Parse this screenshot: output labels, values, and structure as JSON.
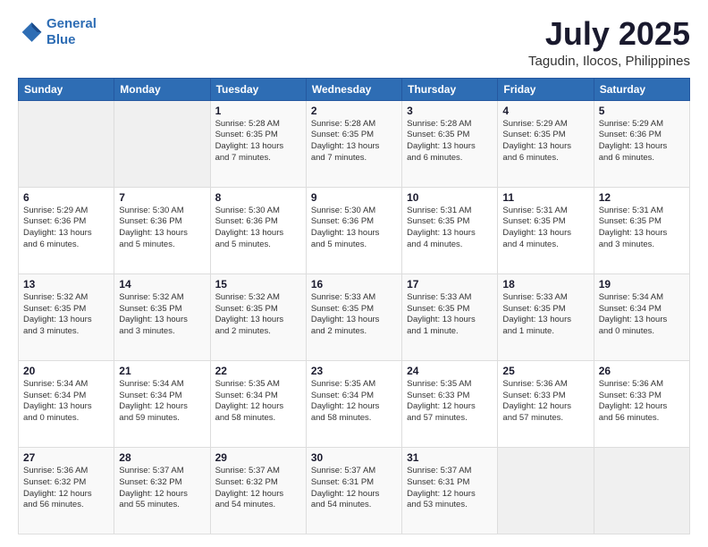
{
  "logo": {
    "line1": "General",
    "line2": "Blue"
  },
  "title": "July 2025",
  "subtitle": "Tagudin, Ilocos, Philippines",
  "weekdays": [
    "Sunday",
    "Monday",
    "Tuesday",
    "Wednesday",
    "Thursday",
    "Friday",
    "Saturday"
  ],
  "weeks": [
    [
      {
        "day": "",
        "info": ""
      },
      {
        "day": "",
        "info": ""
      },
      {
        "day": "1",
        "info": "Sunrise: 5:28 AM\nSunset: 6:35 PM\nDaylight: 13 hours\nand 7 minutes."
      },
      {
        "day": "2",
        "info": "Sunrise: 5:28 AM\nSunset: 6:35 PM\nDaylight: 13 hours\nand 7 minutes."
      },
      {
        "day": "3",
        "info": "Sunrise: 5:28 AM\nSunset: 6:35 PM\nDaylight: 13 hours\nand 6 minutes."
      },
      {
        "day": "4",
        "info": "Sunrise: 5:29 AM\nSunset: 6:35 PM\nDaylight: 13 hours\nand 6 minutes."
      },
      {
        "day": "5",
        "info": "Sunrise: 5:29 AM\nSunset: 6:36 PM\nDaylight: 13 hours\nand 6 minutes."
      }
    ],
    [
      {
        "day": "6",
        "info": "Sunrise: 5:29 AM\nSunset: 6:36 PM\nDaylight: 13 hours\nand 6 minutes."
      },
      {
        "day": "7",
        "info": "Sunrise: 5:30 AM\nSunset: 6:36 PM\nDaylight: 13 hours\nand 5 minutes."
      },
      {
        "day": "8",
        "info": "Sunrise: 5:30 AM\nSunset: 6:36 PM\nDaylight: 13 hours\nand 5 minutes."
      },
      {
        "day": "9",
        "info": "Sunrise: 5:30 AM\nSunset: 6:36 PM\nDaylight: 13 hours\nand 5 minutes."
      },
      {
        "day": "10",
        "info": "Sunrise: 5:31 AM\nSunset: 6:35 PM\nDaylight: 13 hours\nand 4 minutes."
      },
      {
        "day": "11",
        "info": "Sunrise: 5:31 AM\nSunset: 6:35 PM\nDaylight: 13 hours\nand 4 minutes."
      },
      {
        "day": "12",
        "info": "Sunrise: 5:31 AM\nSunset: 6:35 PM\nDaylight: 13 hours\nand 3 minutes."
      }
    ],
    [
      {
        "day": "13",
        "info": "Sunrise: 5:32 AM\nSunset: 6:35 PM\nDaylight: 13 hours\nand 3 minutes."
      },
      {
        "day": "14",
        "info": "Sunrise: 5:32 AM\nSunset: 6:35 PM\nDaylight: 13 hours\nand 3 minutes."
      },
      {
        "day": "15",
        "info": "Sunrise: 5:32 AM\nSunset: 6:35 PM\nDaylight: 13 hours\nand 2 minutes."
      },
      {
        "day": "16",
        "info": "Sunrise: 5:33 AM\nSunset: 6:35 PM\nDaylight: 13 hours\nand 2 minutes."
      },
      {
        "day": "17",
        "info": "Sunrise: 5:33 AM\nSunset: 6:35 PM\nDaylight: 13 hours\nand 1 minute."
      },
      {
        "day": "18",
        "info": "Sunrise: 5:33 AM\nSunset: 6:35 PM\nDaylight: 13 hours\nand 1 minute."
      },
      {
        "day": "19",
        "info": "Sunrise: 5:34 AM\nSunset: 6:34 PM\nDaylight: 13 hours\nand 0 minutes."
      }
    ],
    [
      {
        "day": "20",
        "info": "Sunrise: 5:34 AM\nSunset: 6:34 PM\nDaylight: 13 hours\nand 0 minutes."
      },
      {
        "day": "21",
        "info": "Sunrise: 5:34 AM\nSunset: 6:34 PM\nDaylight: 12 hours\nand 59 minutes."
      },
      {
        "day": "22",
        "info": "Sunrise: 5:35 AM\nSunset: 6:34 PM\nDaylight: 12 hours\nand 58 minutes."
      },
      {
        "day": "23",
        "info": "Sunrise: 5:35 AM\nSunset: 6:34 PM\nDaylight: 12 hours\nand 58 minutes."
      },
      {
        "day": "24",
        "info": "Sunrise: 5:35 AM\nSunset: 6:33 PM\nDaylight: 12 hours\nand 57 minutes."
      },
      {
        "day": "25",
        "info": "Sunrise: 5:36 AM\nSunset: 6:33 PM\nDaylight: 12 hours\nand 57 minutes."
      },
      {
        "day": "26",
        "info": "Sunrise: 5:36 AM\nSunset: 6:33 PM\nDaylight: 12 hours\nand 56 minutes."
      }
    ],
    [
      {
        "day": "27",
        "info": "Sunrise: 5:36 AM\nSunset: 6:32 PM\nDaylight: 12 hours\nand 56 minutes."
      },
      {
        "day": "28",
        "info": "Sunrise: 5:37 AM\nSunset: 6:32 PM\nDaylight: 12 hours\nand 55 minutes."
      },
      {
        "day": "29",
        "info": "Sunrise: 5:37 AM\nSunset: 6:32 PM\nDaylight: 12 hours\nand 54 minutes."
      },
      {
        "day": "30",
        "info": "Sunrise: 5:37 AM\nSunset: 6:31 PM\nDaylight: 12 hours\nand 54 minutes."
      },
      {
        "day": "31",
        "info": "Sunrise: 5:37 AM\nSunset: 6:31 PM\nDaylight: 12 hours\nand 53 minutes."
      },
      {
        "day": "",
        "info": ""
      },
      {
        "day": "",
        "info": ""
      }
    ]
  ]
}
